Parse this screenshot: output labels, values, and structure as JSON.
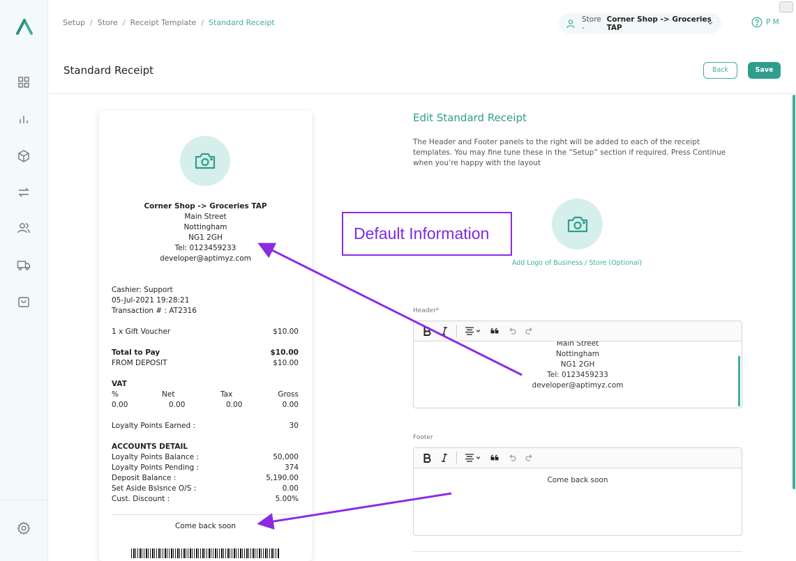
{
  "sidebar": {
    "logo": "brand-logo",
    "items": [
      "dashboard-icon",
      "reports-icon",
      "products-icon",
      "transfers-icon",
      "customers-icon",
      "delivery-icon",
      "orders-icon"
    ],
    "settings": "gear-icon"
  },
  "breadcrumb": {
    "items": [
      "Setup",
      "Store",
      "Receipt Template"
    ],
    "separator": "/",
    "active": "Standard Receipt"
  },
  "store_selector": {
    "prefix": "Store -",
    "value": "Corner Shop -> Groceries TAP"
  },
  "help": {
    "user": "P M"
  },
  "page": {
    "title": "Standard Receipt",
    "back_label": "Back",
    "save_label": "Save"
  },
  "receipt": {
    "store_name": "Corner Shop -> Groceries TAP",
    "address": [
      "Main Street",
      "Nottingham",
      "NG1 2GH",
      "Tel: 0123459233",
      "developer@aptimyz.com"
    ],
    "cashier": "Cashier: Support",
    "datetime": "05-Jul-2021 19:28:21",
    "transaction": "Transaction # : AT2316",
    "item": {
      "label": "1 x Gift Voucher",
      "amount": "$10.00"
    },
    "total": {
      "label": "Total to Pay",
      "amount": "$10.00"
    },
    "deposit": {
      "label": "FROM DEPOSIT",
      "amount": "$10.00"
    },
    "vat": {
      "heading": "VAT",
      "headers": [
        "%",
        "Net",
        "Tax",
        "Gross"
      ],
      "values": [
        "0.00",
        "0.00",
        "0.00",
        "0.00"
      ]
    },
    "loyalty_earned": {
      "label": "Loyalty Points Earned :",
      "value": "30"
    },
    "accounts": {
      "heading": "ACCOUNTS DETAIL",
      "rows": [
        {
          "label": "Loyalty Points Balance :",
          "value": "50,000"
        },
        {
          "label": "Loyalty Points Pending :",
          "value": "374"
        },
        {
          "label": "Deposit Balance :",
          "value": "5,190.00"
        },
        {
          "label": "Set Aside Bslsnce O/S :",
          "value": "0.00"
        },
        {
          "label": "Cust. Discount :",
          "value": "5.00%"
        }
      ]
    },
    "footer": "Come back soon"
  },
  "edit": {
    "title": "Edit Standard Receipt",
    "description": "The Header and Footer panels to the right will be added to each of the receipt templates. You may fine tune these in the “Setup” section if required. Press Continue when you’re happy with the layout",
    "logo_link": "Add Logo of Business / Store (Optional)",
    "header_label": "Header*",
    "header_lines": [
      "Main Street",
      "Nottingham",
      "NG1 2GH",
      "Tel: 0123459233",
      "developer@aptimyz.com"
    ],
    "footer_label": "Footer",
    "footer_text": "Come back soon"
  },
  "annotation": {
    "text": "Default Information",
    "color": "#8a2be2"
  },
  "colors": {
    "accent": "#3fae9c",
    "button": "#2f9e8c",
    "annotation": "#8a2be2"
  }
}
